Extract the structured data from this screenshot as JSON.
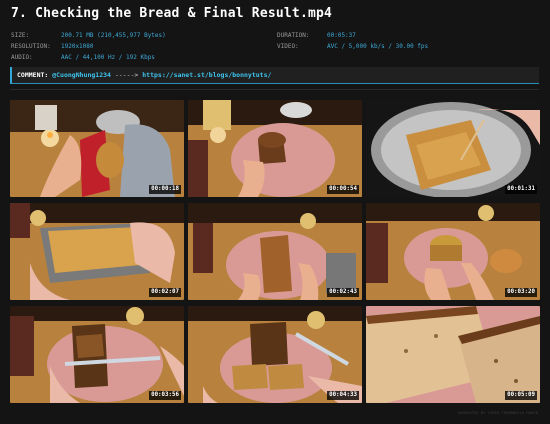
{
  "title": "7. Checking the Bread & Final Result.mp4",
  "meta": {
    "size_label": "SIZE:",
    "size_value": "200.71 MB (210,455,977 Bytes)",
    "resolution_label": "RESOLUTION:",
    "resolution_value": "1920x1080",
    "audio_label": "AUDIO:",
    "audio_value": "AAC / 44,100 Hz / 192 Kbps",
    "duration_label": "DURATION:",
    "duration_value": "00:05:37",
    "video_label": "VIDEO:",
    "video_value": "AVC / 5,000 kb/s / 30.00 fps"
  },
  "comment": {
    "label": "COMMENT:",
    "user": "@CuongNhung1234",
    "arrow": "----->",
    "url": "https://sanet.st/blogs/bonnytuts/"
  },
  "thumbnails": [
    {
      "timestamp": "00:00:18"
    },
    {
      "timestamp": "00:00:54"
    },
    {
      "timestamp": "00:01:31"
    },
    {
      "timestamp": "00:02:07"
    },
    {
      "timestamp": "00:02:43"
    },
    {
      "timestamp": "00:03:20"
    },
    {
      "timestamp": "00:03:56"
    },
    {
      "timestamp": "00:04:33"
    },
    {
      "timestamp": "00:05:09"
    }
  ],
  "footer": "GENERATED BY VIDEO THUMBNAILS MAKER",
  "colors": {
    "background": "#141414",
    "accent": "#3fa9d6",
    "title": "#ffffff"
  }
}
